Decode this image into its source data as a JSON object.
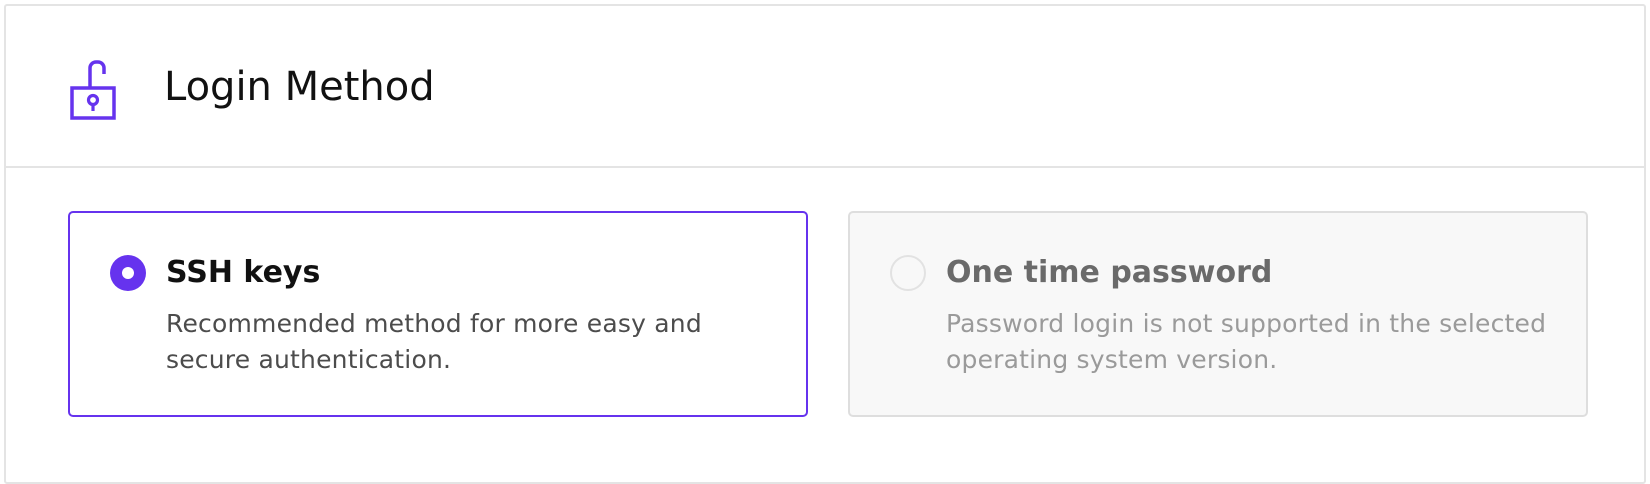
{
  "panel": {
    "title": "Login Method",
    "icon": "unlocked-padlock-icon",
    "accent_color": "#6633ee"
  },
  "options": [
    {
      "title": "SSH keys",
      "description": "Recommended method for more easy and secure authentication.",
      "selected": true,
      "disabled": false
    },
    {
      "title": "One time password",
      "description": "Password login is not supported in the selected operating system version.",
      "selected": false,
      "disabled": true
    }
  ]
}
